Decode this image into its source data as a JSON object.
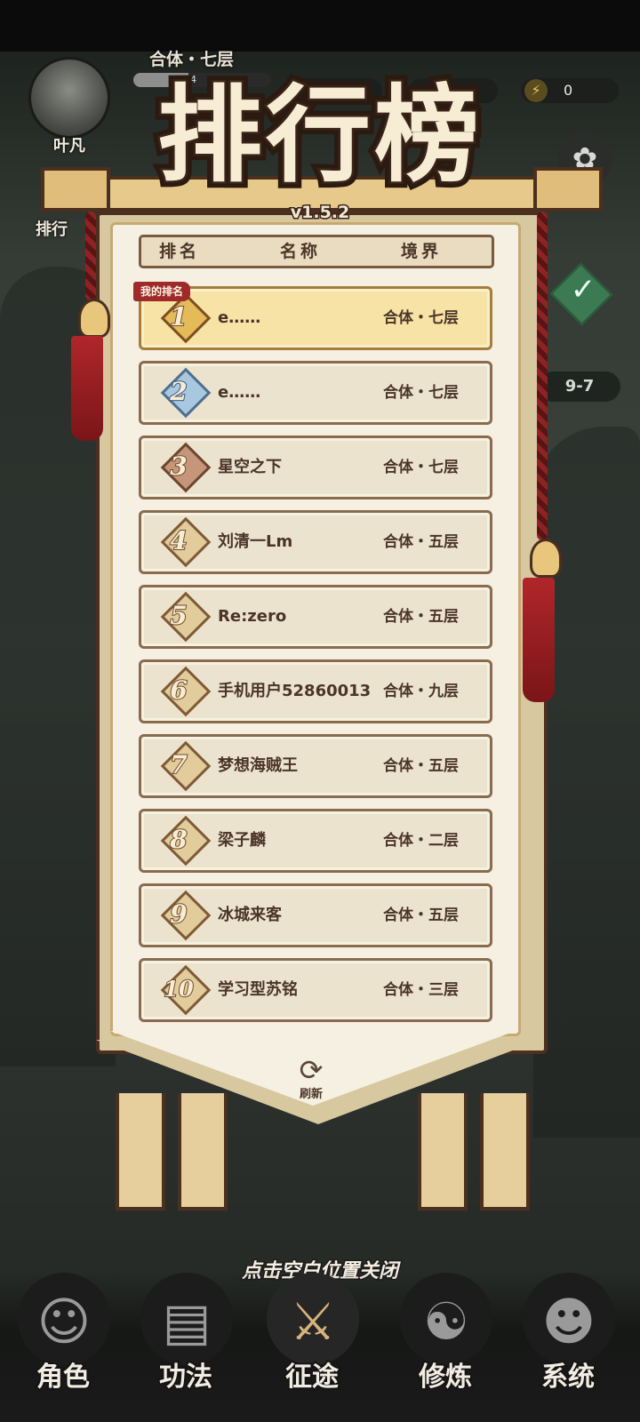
{
  "header": {
    "player_name": "叶凡",
    "realm": "合体・七层",
    "exp_text": "934",
    "currency_value": "0",
    "side_rank_label": "排行",
    "stage": "9-7"
  },
  "leaderboard": {
    "title": "排行榜",
    "version": "v1.5.2",
    "columns": [
      "排名",
      "名称",
      "境界"
    ],
    "my_rank_tag": "我的排名",
    "rows": [
      {
        "rank": "1",
        "name": "e……",
        "realm": "合体・七层",
        "me": true
      },
      {
        "rank": "2",
        "name": "e……",
        "realm": "合体・七层"
      },
      {
        "rank": "3",
        "name": "星空之下",
        "realm": "合体・七层"
      },
      {
        "rank": "4",
        "name": "刘清一Lm",
        "realm": "合体・五层"
      },
      {
        "rank": "5",
        "name": "Re:zero",
        "realm": "合体・五层"
      },
      {
        "rank": "6",
        "name": "手机用户52860013",
        "realm": "合体・九层"
      },
      {
        "rank": "7",
        "name": "梦想海贼王",
        "realm": "合体・五层"
      },
      {
        "rank": "8",
        "name": "梁子麟",
        "realm": "合体・二层"
      },
      {
        "rank": "9",
        "name": "冰城来客",
        "realm": "合体・五层"
      },
      {
        "rank": "10",
        "name": "学习型苏铭",
        "realm": "合体・三层"
      }
    ],
    "refresh_label": "刷新"
  },
  "hint": "点击空白位置关闭",
  "nav": {
    "items": [
      {
        "label": "角色",
        "icon": "character-icon"
      },
      {
        "label": "功法",
        "icon": "book-icon"
      },
      {
        "label": "征途",
        "icon": "sword-icon"
      },
      {
        "label": "修炼",
        "icon": "meditation-icon"
      },
      {
        "label": "系统",
        "icon": "system-icon"
      }
    ]
  },
  "colors": {
    "accent_gold": "#e5ba59",
    "banner_red": "#9e2a2a",
    "panel": "#f5f0e2"
  }
}
